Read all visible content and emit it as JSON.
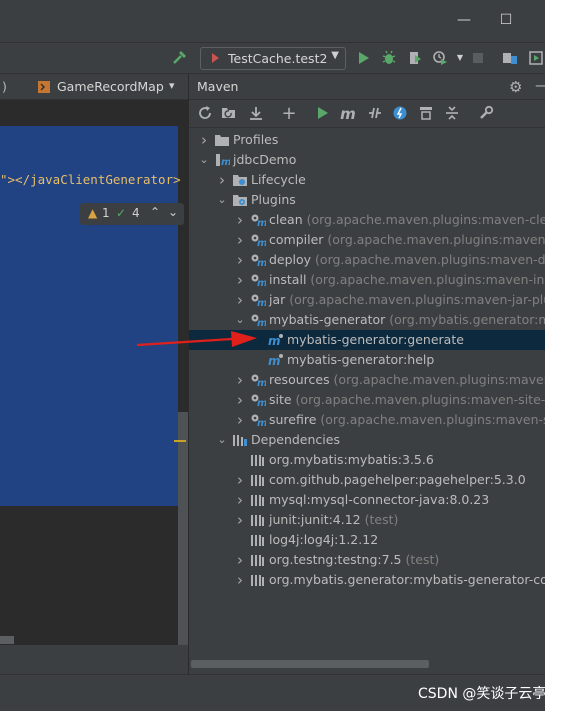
{
  "window": {
    "minimize_glyph": "—",
    "maximize_glyph": "☐"
  },
  "run_toolbar": {
    "config_name": "TestCache.test2"
  },
  "editor": {
    "tab_prefix": ")",
    "tab_label": "GameRecordMap",
    "code_line": "\"></javaClientGenerator>",
    "warnings_count": "1",
    "checks_count": "4"
  },
  "maven": {
    "title": "Maven",
    "tree": [
      {
        "label": "Profiles",
        "detail": "",
        "icon": "folder-icon",
        "level": 0,
        "expand": "collapsed"
      },
      {
        "label": "jdbcDemo",
        "detail": "",
        "icon": "maven-project-icon",
        "level": 0,
        "expand": "expanded"
      },
      {
        "label": "Lifecycle",
        "detail": "",
        "icon": "lifecycle-folder-icon",
        "level": 1,
        "expand": "collapsed"
      },
      {
        "label": "Plugins",
        "detail": "",
        "icon": "plugins-folder-icon",
        "level": 1,
        "expand": "expanded"
      },
      {
        "label": "clean",
        "detail": "(org.apache.maven.plugins:maven-clean-p",
        "icon": "plugin-icon",
        "level": 2,
        "expand": "collapsed"
      },
      {
        "label": "compiler",
        "detail": "(org.apache.maven.plugins:maven-com",
        "icon": "plugin-icon",
        "level": 2,
        "expand": "collapsed"
      },
      {
        "label": "deploy",
        "detail": "(org.apache.maven.plugins:maven-deplo",
        "icon": "plugin-icon",
        "level": 2,
        "expand": "collapsed"
      },
      {
        "label": "install",
        "detail": "(org.apache.maven.plugins:maven-install-",
        "icon": "plugin-icon",
        "level": 2,
        "expand": "collapsed"
      },
      {
        "label": "jar",
        "detail": "(org.apache.maven.plugins:maven-jar-plugin",
        "icon": "plugin-icon",
        "level": 2,
        "expand": "collapsed"
      },
      {
        "label": "mybatis-generator",
        "detail": "(org.mybatis.generator:myba",
        "icon": "plugin-icon",
        "level": 2,
        "expand": "expanded"
      },
      {
        "label": "mybatis-generator:generate",
        "detail": "",
        "icon": "goal-icon",
        "level": 3,
        "expand": "none",
        "selected": true
      },
      {
        "label": "mybatis-generator:help",
        "detail": "",
        "icon": "goal-icon",
        "level": 3,
        "expand": "none"
      },
      {
        "label": "resources",
        "detail": "(org.apache.maven.plugins:maven-re",
        "icon": "plugin-icon",
        "level": 2,
        "expand": "collapsed"
      },
      {
        "label": "site",
        "detail": "(org.apache.maven.plugins:maven-site-plug",
        "icon": "plugin-icon",
        "level": 2,
        "expand": "collapsed"
      },
      {
        "label": "surefire",
        "detail": "(org.apache.maven.plugins:maven-sure",
        "icon": "plugin-icon",
        "level": 2,
        "expand": "collapsed"
      },
      {
        "label": "Dependencies",
        "detail": "",
        "icon": "dependencies-folder-icon",
        "level": 1,
        "expand": "expanded"
      },
      {
        "label": "org.mybatis:mybatis:3.5.6",
        "detail": "",
        "icon": "library-icon",
        "level": 2,
        "expand": "none"
      },
      {
        "label": "com.github.pagehelper:pagehelper:5.3.0",
        "detail": "",
        "icon": "library-icon",
        "level": 2,
        "expand": "collapsed"
      },
      {
        "label": "mysql:mysql-connector-java:8.0.23",
        "detail": "",
        "icon": "library-icon",
        "level": 2,
        "expand": "collapsed"
      },
      {
        "label": "junit:junit:4.12",
        "detail": "(test)",
        "icon": "library-icon",
        "level": 2,
        "expand": "collapsed"
      },
      {
        "label": "log4j:log4j:1.2.12",
        "detail": "",
        "icon": "library-icon",
        "level": 2,
        "expand": "none"
      },
      {
        "label": "org.testng:testng:7.5",
        "detail": "(test)",
        "icon": "library-icon",
        "level": 2,
        "expand": "collapsed"
      },
      {
        "label": "org.mybatis.generator:mybatis-generator-core:",
        "detail": "",
        "icon": "library-icon",
        "level": 2,
        "expand": "collapsed"
      }
    ]
  },
  "colors": {
    "panel_bg": "#3c3f41",
    "editor_bg": "#2b2b2b",
    "editor_selection": "#214283",
    "tree_selected": "#0d293e",
    "run_green": "#59a869",
    "arrow_red": "#e0201a",
    "maven_blue": "#3d8fd1"
  },
  "watermark": "CSDN @笑谈子云亭"
}
